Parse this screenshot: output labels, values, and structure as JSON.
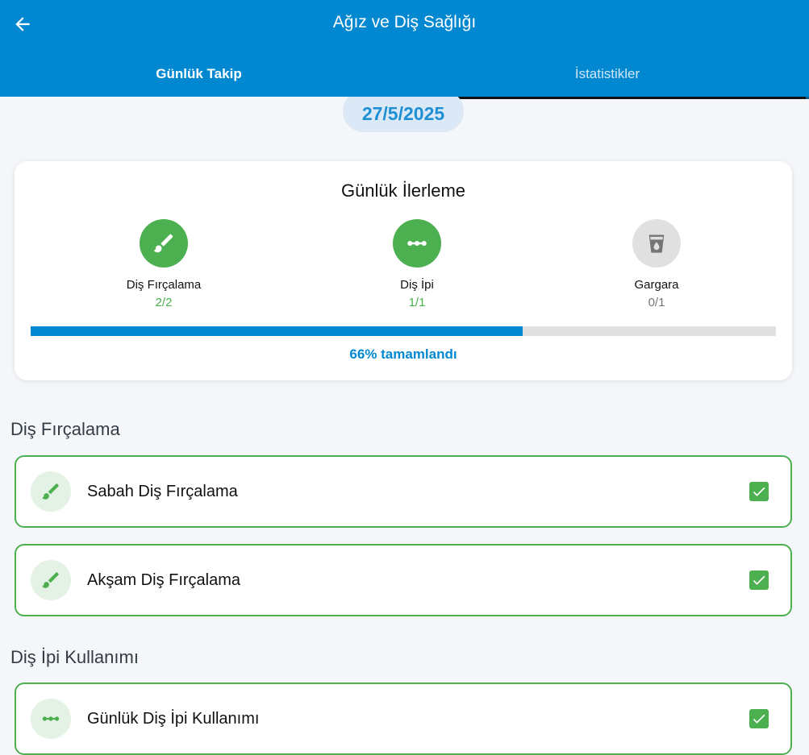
{
  "header": {
    "title": "Ağız ve Diş Sağlığı",
    "back_icon": "arrow-left-icon"
  },
  "tabs": [
    {
      "label": "Günlük Takip",
      "active": true
    },
    {
      "label": "İstatistikler",
      "active": false
    }
  ],
  "date": "27/5/2025",
  "progress": {
    "title": "Günlük İlerleme",
    "items": [
      {
        "label": "Diş Fırçalama",
        "count": "2/2",
        "icon": "toothbrush-icon",
        "done": true
      },
      {
        "label": "Diş İpi",
        "count": "1/1",
        "icon": "floss-icon",
        "done": true
      },
      {
        "label": "Gargara",
        "count": "0/1",
        "icon": "mouthwash-cup-icon",
        "done": false
      }
    ],
    "percent": 66,
    "percent_text": "66% tamamlandı"
  },
  "sections": [
    {
      "title": "Diş Fırçalama",
      "tasks": [
        {
          "label": "Sabah Diş Fırçalama",
          "icon": "toothbrush-icon",
          "checked": true
        },
        {
          "label": "Akşam Diş Fırçalama",
          "icon": "toothbrush-icon",
          "checked": true
        }
      ]
    },
    {
      "title": "Diş İpi Kullanımı",
      "tasks": [
        {
          "label": "Günlük Diş İpi Kullanımı",
          "icon": "floss-icon",
          "checked": true
        }
      ]
    }
  ],
  "colors": {
    "primary": "#0288d1",
    "success": "#4caf50",
    "pending": "#e0e0e0",
    "background": "#f4f6fa"
  }
}
